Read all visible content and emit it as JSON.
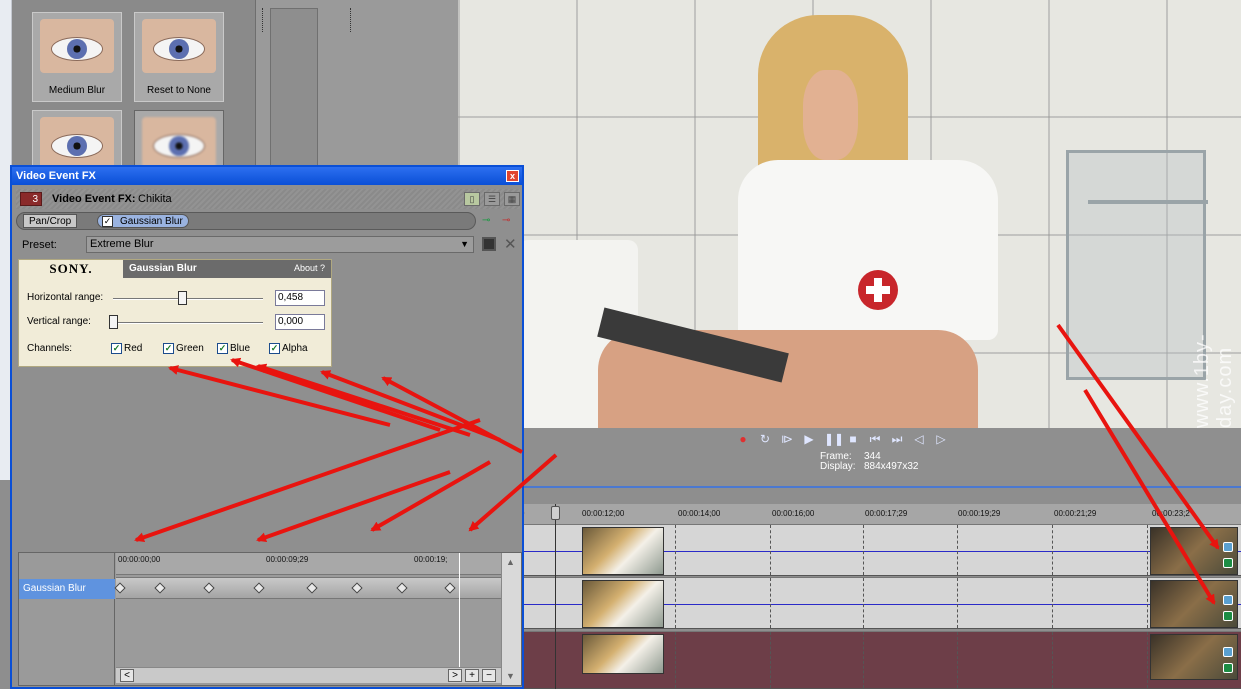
{
  "presets": {
    "tiles": [
      {
        "label": "Medium Blur"
      },
      {
        "label": "Reset to None"
      },
      {
        "label": ""
      },
      {
        "label": ""
      }
    ]
  },
  "preview": {
    "watermark": "www.1by-day.com",
    "frame_label": "Frame:",
    "frame_value": "344",
    "display_label": "Display:",
    "display_value": "884x497x32"
  },
  "transport": {
    "icons": [
      "record-icon",
      "loop-icon",
      "play-from-start-icon",
      "play-icon",
      "pause-icon",
      "stop-icon",
      "prev-frame-icon",
      "next-frame-icon",
      "prev-marker-icon",
      "next-marker-icon"
    ]
  },
  "timeline": {
    "ticks": [
      "00:00:12;00",
      "00:00:14;00",
      "00:00:16;00",
      "00:00:17;29",
      "00:00:19;29",
      "00:00:21;29",
      "00:00:23;2"
    ],
    "tick_partial": "0"
  },
  "fx": {
    "title": "Video Event FX",
    "close": "x",
    "num": "3",
    "head_label": "Video Event FX:",
    "head_name": "Chikita",
    "chain": {
      "pancrop": "Pan/Crop",
      "gauss": "Gaussian Blur",
      "gauss_checked": "✓"
    },
    "preset_label": "Preset:",
    "preset_value": "Extreme Blur",
    "delete": "✕",
    "plugin": {
      "brand": "SONY.",
      "name": "Gaussian Blur",
      "about": "About ?",
      "h_label": "Horizontal range:",
      "h_value": "0,458",
      "h_fraction": 0.458,
      "v_label": "Vertical range:",
      "v_value": "0,000",
      "v_fraction": 0.0,
      "channels_label": "Channels:",
      "channels": [
        {
          "label": "Red",
          "checked": "✓"
        },
        {
          "label": "Green",
          "checked": "✓"
        },
        {
          "label": "Blue",
          "checked": "✓"
        },
        {
          "label": "Alpha",
          "checked": "✓"
        }
      ]
    },
    "keyframes": {
      "row_label": "Gaussian Blur",
      "ruler": [
        "00:00:00;00",
        "00:00:09;29",
        "00:00:19;"
      ],
      "hscroll": {
        "left": "<",
        "right": ">",
        "plus": "+",
        "minus": "−"
      }
    }
  },
  "colors": {
    "accent_blue": "#0a4fd6",
    "arrow_red": "#e8140f",
    "track_maroon": "#6d3e48"
  }
}
